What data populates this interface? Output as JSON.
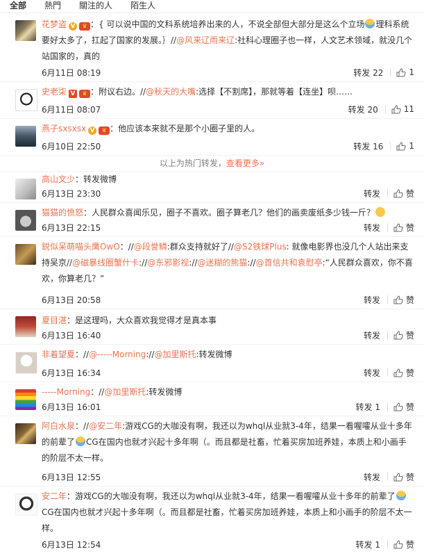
{
  "tabs": [
    {
      "label": "全部"
    },
    {
      "label": "熱門"
    },
    {
      "label": "關注的人"
    },
    {
      "label": "陌生人"
    }
  ],
  "hot": [
    {
      "user": "花梦盗",
      "text": "：{ 可以说中国的文科系统培养出来的人，不说全部但大部分是这么个立场",
      "text2": "理科系统要好太多了，扛起了国家的发展。｝//",
      "mention": "@风来辽雨来辽",
      "text3": ":社科心理圈子也一样，人文艺术领域，就没几个站国家的，真的",
      "time": "6月11日 08:19",
      "repost": "转发 22",
      "likes": "1"
    },
    {
      "user": "史老柒",
      "text": "：附议右边。//",
      "mention": "@秋天的大嘴",
      "text3": ":选择【不割席】，那就等着【连坐】呗……",
      "time": "6月11日 08:07",
      "repost": "转发 20",
      "likes": "11"
    },
    {
      "user": "燕子sxsxsx",
      "text": "：他应该本来就不是那个小圈子里的人。",
      "time": "6月10日 22:50",
      "repost": "转发 16",
      "likes": "1"
    }
  ],
  "divider": {
    "text": "以上为热门转发，",
    "more": "查看更多»"
  },
  "items": [
    {
      "user": "高山文少",
      "text": "：转发微博",
      "time": "6月13日 23:30",
      "repost": "转发",
      "like": "赞"
    },
    {
      "user": "猫猫的愤怒",
      "text": "：人民群众喜闻乐见，圈子不喜欢。圈子算老几？他们的画卖废纸多少钱一斤？",
      "time": "6月13日 22:15",
      "repost": "转发",
      "like": "赞"
    },
    {
      "user": "鋭似呆萌喵头鹰OwO",
      "text": "：//",
      "m1": "@段誉鳞",
      "t1": ":群众支持就好了//",
      "m2": "@S2铁球Plus",
      "t2": ": 就像电影界也没几个人站出来支持吴京//",
      "m3": "@磁暴线圈蟹什卡",
      "t3": ":",
      "m4": "@东邪影视",
      "t4": ":",
      "m5": "@迷糊的熊猫",
      "t5": ":",
      "m6": "@首信共和袁慰亭",
      "t6": ":“人民群众喜欢，你不喜欢，你算老几？”",
      "time": "6月13日 20:58",
      "repost": "转发",
      "like": "赞"
    },
    {
      "user": "夏目湛",
      "text": "：是这理吗，大众喜欢我觉得才是真本事",
      "time": "6月13日 16:40",
      "repost": "转发",
      "like": "赞"
    },
    {
      "user": "非着望夏",
      "text": "：//",
      "m1": "@-----Morning",
      "t1": ":",
      "m2": "@加里斯托",
      "t2": ":转发微博",
      "time": "6月13日 16:34",
      "repost": "转发",
      "like": "赞"
    },
    {
      "user": "-----Morning",
      "text": "：//",
      "m1": "@加里斯托",
      "t1": ":转发微博",
      "time": "6月13日 16:01",
      "repost": "转发 1",
      "like": "赞"
    },
    {
      "user": "阿白水泉",
      "text": "：//",
      "m1": "@安二年",
      "t1": ":游戏CG的大咖没有啊，我还以为whql从业就3-4年，结果一看喔嚯从业十多年的前辈了",
      "t2": "CG在国内也就才兴起十多年啊（。而且都是社畜，忙着买房加班养娃，本质上和小画手的阶层不太一样。",
      "time": "6月13日 12:55",
      "repost": "转发",
      "like": "赞"
    },
    {
      "user": "安二年",
      "text": "：游戏CG的大咖没有啊，我还以为whql从业就3-4年，结果一看喔嚯从业十多年的前辈了",
      "t2": "CG在国内也就才兴起十多年啊（。而且都是社畜，忙着买房加班养娃，本质上和小画手的阶层不太一样。",
      "time": "6月13日 12:54",
      "repost": "转发 1",
      "like": "赞"
    }
  ],
  "colors": {
    "accent": "#eb7350",
    "text": "#333333",
    "muted": "#808080"
  }
}
